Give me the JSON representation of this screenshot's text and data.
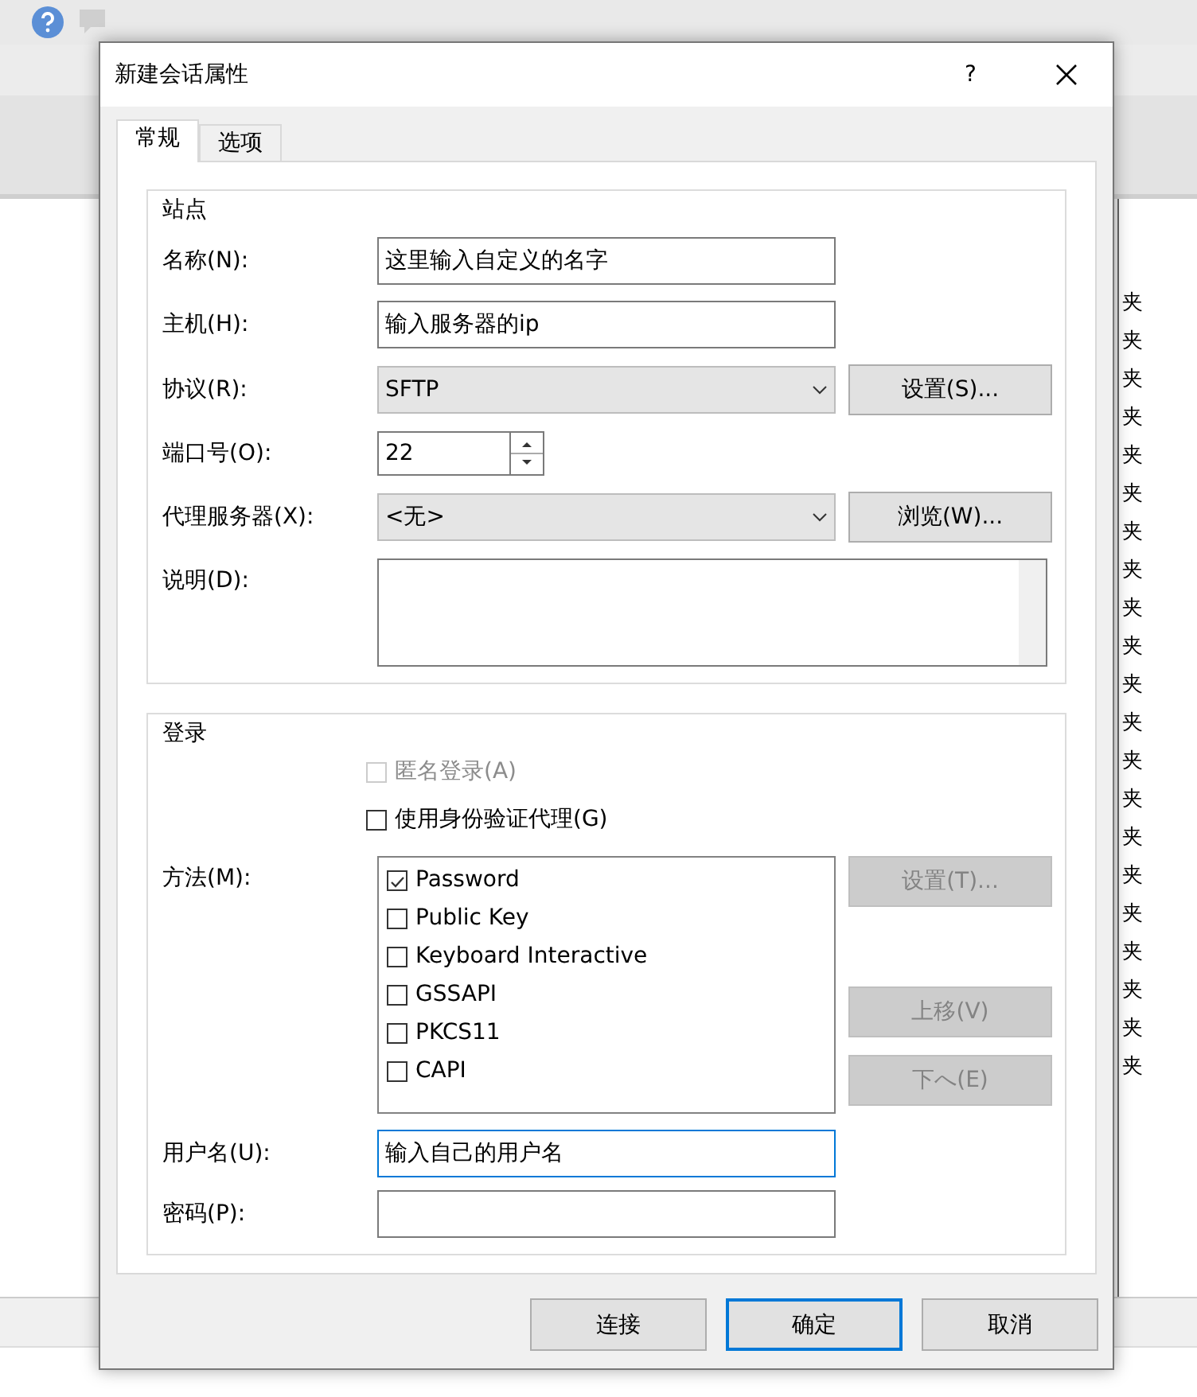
{
  "app": {
    "right_column": [
      "夹",
      "夹",
      "夹",
      "夹",
      "夹",
      "夹",
      "夹",
      "夹",
      "夹",
      "夹",
      "夹",
      "夹",
      "夹",
      "夹",
      "夹",
      "夹",
      "夹",
      "夹",
      "夹",
      "夹",
      "夹"
    ]
  },
  "dialog": {
    "title": "新建会话属性",
    "help": "?",
    "tabs": [
      {
        "label": "常规",
        "selected": true
      },
      {
        "label": "选项",
        "selected": false
      }
    ],
    "site": {
      "title": "站点",
      "rows": [
        {
          "kind": "text",
          "label": "名称(N):",
          "value": "这里输入自定义的名字"
        },
        {
          "kind": "text",
          "label": "主机(H):",
          "value": "输入服务器的ip"
        },
        {
          "kind": "select",
          "label": "协议(R):",
          "value": "SFTP",
          "button": "设置(S)..."
        },
        {
          "kind": "spin",
          "label": "端口号(O):",
          "value": "22"
        },
        {
          "kind": "select",
          "label": "代理服务器(X):",
          "value": "<无>",
          "button": "浏览(W)..."
        },
        {
          "kind": "textarea",
          "label": "说明(D):"
        }
      ]
    },
    "login": {
      "title": "登录",
      "options": [
        {
          "label": "匿名登录(A)",
          "checked": false,
          "disabled": true
        },
        {
          "label": "使用身份验证代理(G)",
          "checked": false,
          "disabled": false
        }
      ],
      "method_label": "方法(M):",
      "methods": [
        {
          "label": "Password",
          "checked": true
        },
        {
          "label": "Public Key",
          "checked": false
        },
        {
          "label": "Keyboard Interactive",
          "checked": false
        },
        {
          "label": "GSSAPI",
          "checked": false
        },
        {
          "label": "PKCS11",
          "checked": false
        },
        {
          "label": "CAPI",
          "checked": false
        }
      ],
      "method_buttons": [
        {
          "label": "设置(T)...",
          "disabled": true
        },
        {
          "label": "上移(V)",
          "disabled": true
        },
        {
          "label": "下へ(E)",
          "disabled": true
        }
      ],
      "fields": [
        {
          "label": "用户名(U):",
          "value": "输入自己的用户名",
          "focused": true
        },
        {
          "label": "密码(P):",
          "focused": false
        }
      ]
    },
    "buttons": [
      {
        "label": "连接",
        "default": false
      },
      {
        "label": "确定",
        "default": true
      },
      {
        "label": "取消",
        "default": false
      }
    ]
  }
}
